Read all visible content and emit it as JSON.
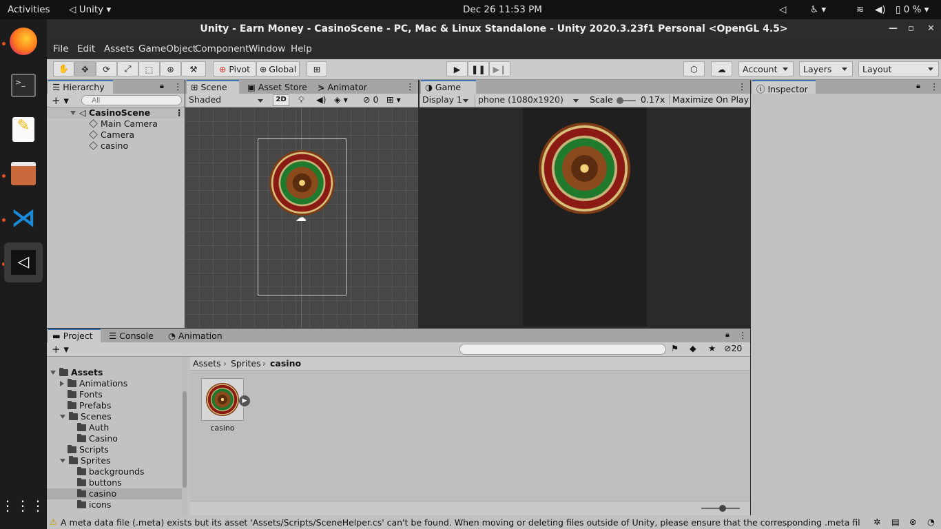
{
  "topbar": {
    "activities": "Activities",
    "app": "Unity",
    "clock": "Dec 26  11:53 PM",
    "battery": "0 %"
  },
  "dock": [
    "firefox-icon",
    "terminal-icon",
    "text-editor-icon",
    "files-icon",
    "vscode-icon",
    "unity-icon",
    "app-grid-icon"
  ],
  "window": {
    "title": "Unity - Earn Money - CasinoScene - PC, Mac & Linux Standalone - Unity 2020.3.23f1 Personal <OpenGL 4.5>"
  },
  "menu": [
    "File",
    "Edit",
    "Assets",
    "GameObject",
    "Component",
    "Window",
    "Help"
  ],
  "toolbar": {
    "pivot": "Pivot",
    "global": "Global",
    "account": "Account",
    "layers": "Layers",
    "layout": "Layout"
  },
  "hierarchy": {
    "tab": "Hierarchy",
    "search_placeholder": "All",
    "scene": "CasinoScene",
    "items": [
      "Main Camera",
      "Camera",
      "casino"
    ]
  },
  "scene": {
    "tabs": [
      "Scene",
      "Asset Store",
      "Animator"
    ],
    "shading": "Shaded",
    "mode2d": "2D",
    "hidden_count": "0"
  },
  "game": {
    "tab": "Game",
    "display": "Display 1",
    "resolution": "phone (1080x1920)",
    "scale_label": "Scale",
    "scale_value": "0.17x",
    "maximize": "Maximize On Play"
  },
  "inspector": {
    "tab": "Inspector"
  },
  "bottom": {
    "tabs": [
      "Project",
      "Console",
      "Animation"
    ],
    "hidden_count": "20"
  },
  "project": {
    "root": "Assets",
    "tree": [
      {
        "label": "Animations",
        "depth": 1,
        "arrow": "right"
      },
      {
        "label": "Fonts",
        "depth": 1,
        "arrow": ""
      },
      {
        "label": "Prefabs",
        "depth": 1,
        "arrow": ""
      },
      {
        "label": "Scenes",
        "depth": 1,
        "arrow": "down"
      },
      {
        "label": "Auth",
        "depth": 2,
        "arrow": ""
      },
      {
        "label": "Casino",
        "depth": 2,
        "arrow": ""
      },
      {
        "label": "Scripts",
        "depth": 1,
        "arrow": ""
      },
      {
        "label": "Sprites",
        "depth": 1,
        "arrow": "down"
      },
      {
        "label": "backgrounds",
        "depth": 2,
        "arrow": ""
      },
      {
        "label": "buttons",
        "depth": 2,
        "arrow": ""
      },
      {
        "label": "casino",
        "depth": 2,
        "arrow": "",
        "selected": true
      },
      {
        "label": "icons",
        "depth": 2,
        "arrow": ""
      }
    ],
    "breadcrumb": [
      "Assets",
      "Sprites",
      "casino"
    ],
    "asset_label": "casino"
  },
  "status": {
    "message": "A meta data file (.meta) exists but its asset 'Assets/Scripts/SceneHelper.cs' can't be found. When moving or deleting files outside of Unity, please ensure that the corresponding .meta file is moved or deleted al"
  }
}
